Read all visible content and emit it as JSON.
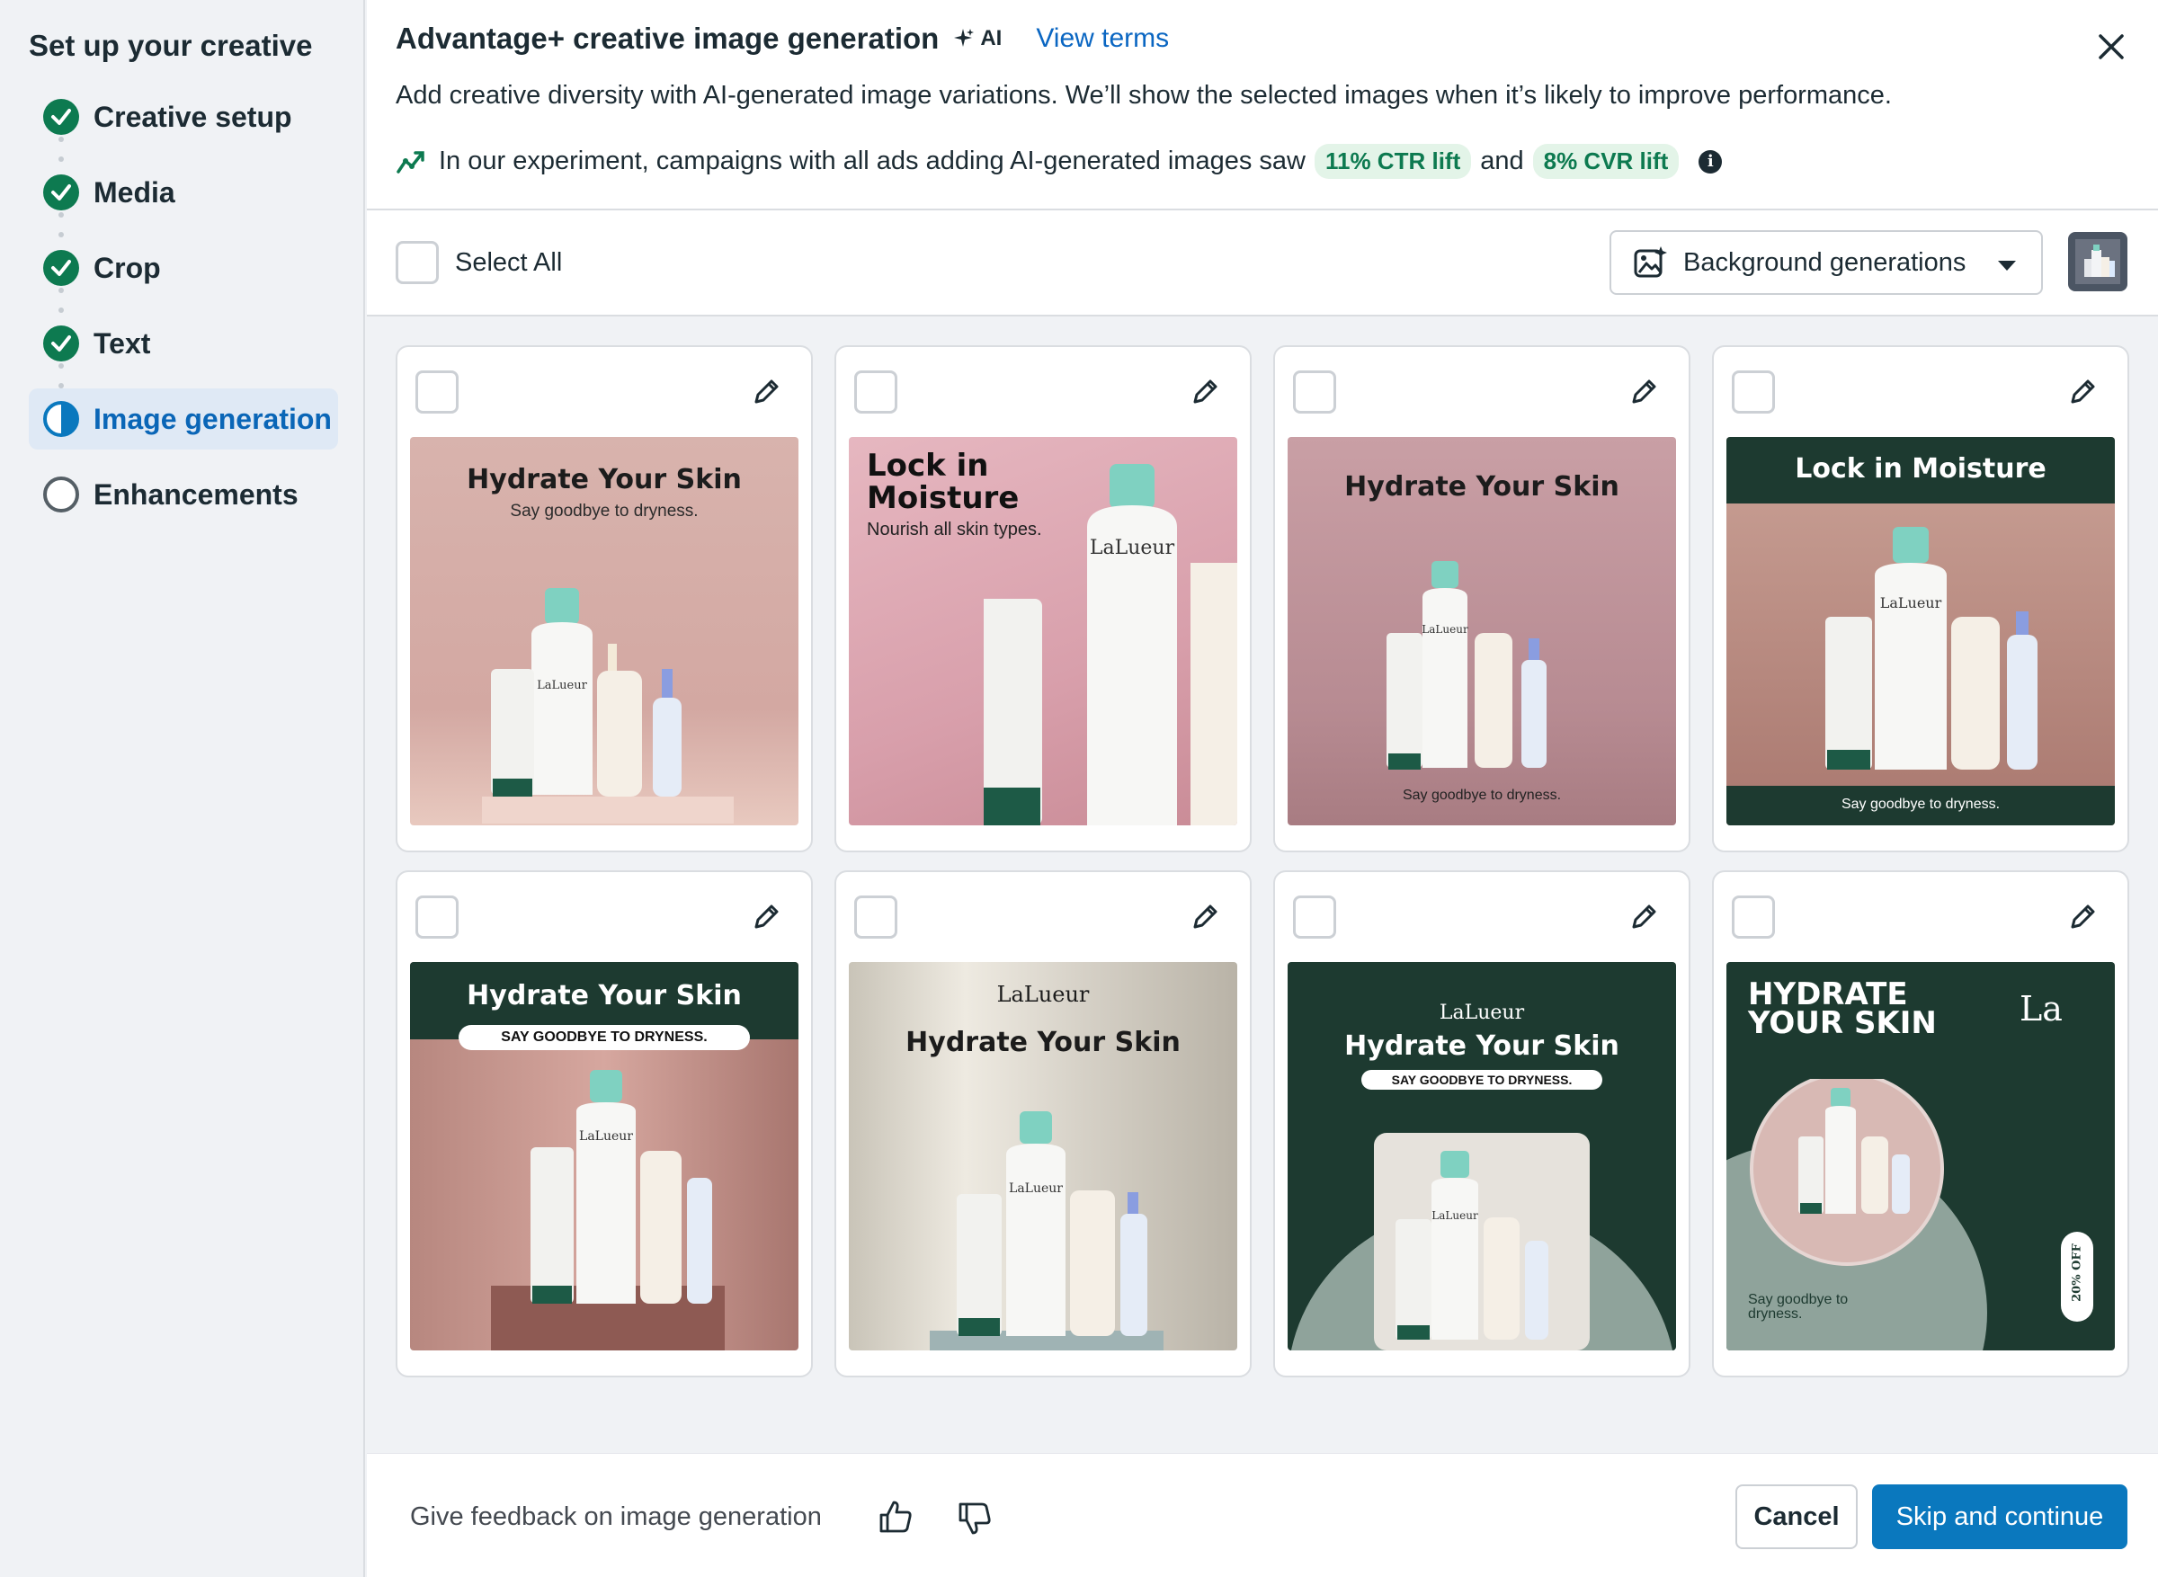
{
  "sidebar": {
    "title": "Set up your creative",
    "steps": [
      {
        "label": "Creative setup",
        "state": "done"
      },
      {
        "label": "Media",
        "state": "done"
      },
      {
        "label": "Crop",
        "state": "done"
      },
      {
        "label": "Text",
        "state": "done"
      },
      {
        "label": "Image generation",
        "state": "active"
      },
      {
        "label": "Enhancements",
        "state": "pending"
      }
    ]
  },
  "header": {
    "title": "Advantage+ creative image generation",
    "ai_badge": "AI",
    "view_terms": "View terms",
    "subtitle": "Add creative diversity with AI-generated image variations. We’ll show the selected images when it’s likely to improve performance.",
    "experiment": {
      "text_before": "In our experiment, campaigns with all ads adding AI-generated images saw",
      "ctr_lift": "11% CTR lift",
      "and": "and",
      "cvr_lift": "8% CVR lift"
    }
  },
  "toolbar": {
    "select_all": "Select All",
    "dropdown_label": "Background generations"
  },
  "brand": "LaLueur",
  "cards": [
    {
      "headline": "Hydrate Your Skin",
      "tagline": "Say goodbye to dryness."
    },
    {
      "headline": "Lock in Moisture",
      "tagline": "Nourish all skin types."
    },
    {
      "headline": "Hydrate Your Skin",
      "tagline": "Say goodbye to dryness."
    },
    {
      "headline": "Lock in Moisture",
      "tagline": "Say goodbye to dryness."
    },
    {
      "headline": "Hydrate Your Skin",
      "tagline": "SAY GOODBYE TO DRYNESS."
    },
    {
      "headline": "Hydrate Your Skin",
      "tagline": ""
    },
    {
      "headline": "Hydrate Your Skin",
      "tagline": "SAY GOODBYE TO DRYNESS."
    },
    {
      "headline": "HYDRATE YOUR SKIN",
      "tagline": "Say goodbye to dryness.",
      "brand_short": "La",
      "badge": "20% OFF"
    }
  ],
  "footer": {
    "feedback": "Give feedback on image generation",
    "cancel": "Cancel",
    "skip": "Skip and continue"
  },
  "colors": {
    "primary": "#0a78be",
    "success": "#0d7a50",
    "dark_green": "#1d3a30",
    "mint": "#7fd1c1"
  }
}
